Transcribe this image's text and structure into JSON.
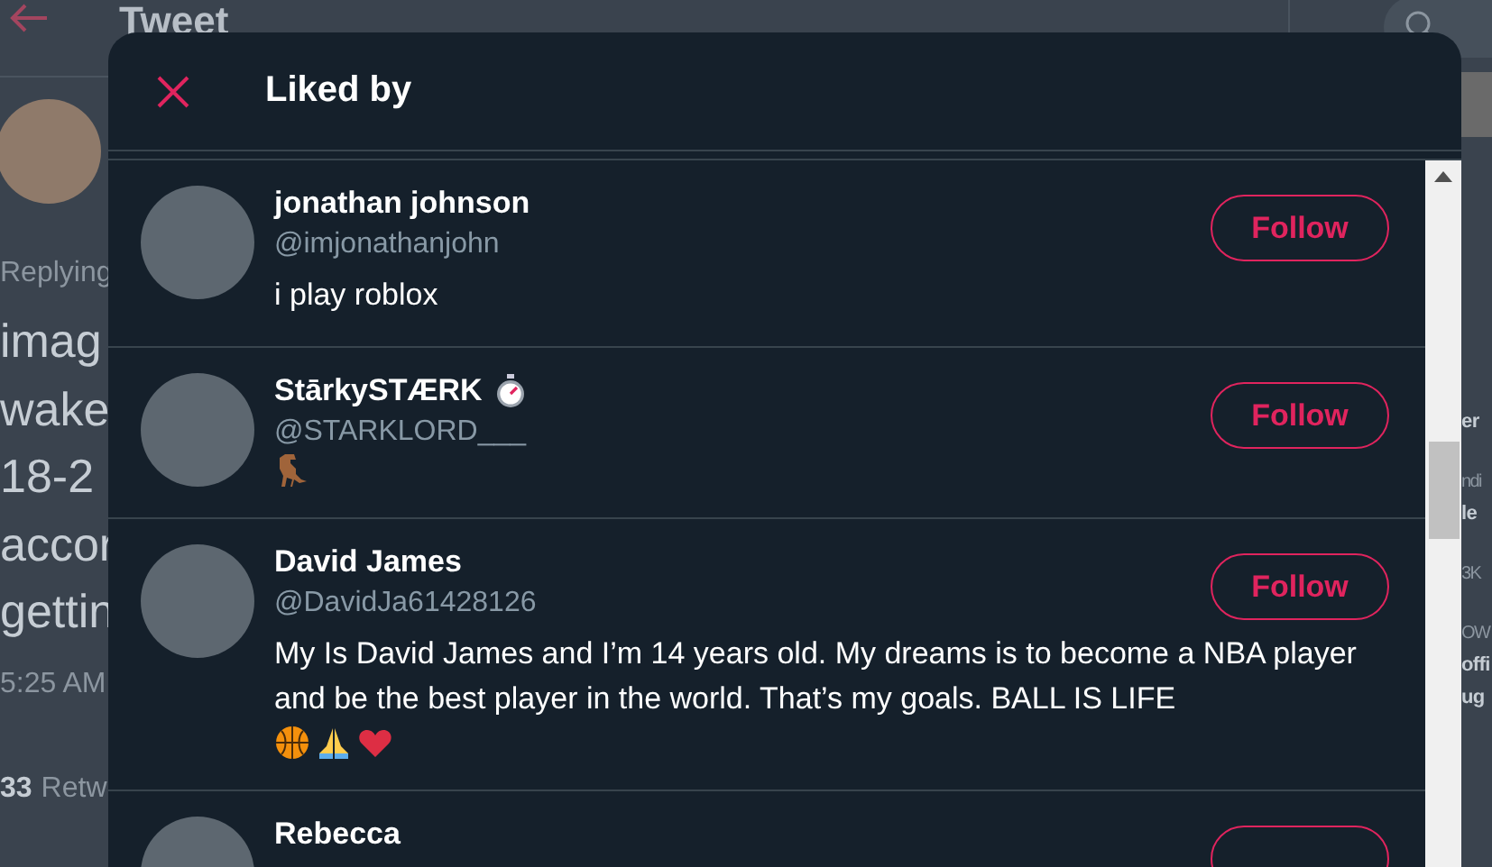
{
  "background_page": {
    "header": {
      "title": "Tweet"
    },
    "tweet": {
      "replying": "Replying",
      "text_lines": [
        "imag",
        "wake",
        "18-2",
        "accor",
        "gettin"
      ],
      "time": "5:25 AM",
      "retweet_count": "33",
      "retweet_label": "Retw"
    },
    "sidebar_fragments": [
      {
        "text": "er",
        "kind": "heading"
      },
      {
        "text": "ndi",
        "kind": "meta"
      },
      {
        "text": "le",
        "kind": "title"
      },
      {
        "text": "3K",
        "kind": "meta"
      },
      {
        "text": "OW",
        "kind": "meta"
      },
      {
        "text": "offi",
        "kind": "title"
      },
      {
        "text": "ug",
        "kind": "title"
      }
    ]
  },
  "modal": {
    "title": "Liked by",
    "users": [
      {
        "name": "jonathan johnson",
        "handle": "@imjonathanjohn",
        "bio": "i play roblox",
        "follow_label": "Follow"
      },
      {
        "name": "StārkySTÆRK",
        "handle": "@STARKLORD___",
        "follow_label": "Follow",
        "name_emojis": [
          {
            "kind": "stopwatch"
          }
        ],
        "bio_emojis": [
          {
            "kind": "dinosaur"
          }
        ]
      },
      {
        "name": "David James",
        "handle": "@DavidJa61428126",
        "bio": "My Is David James and I’m 14 years old. My dreams is to become a NBA player and be the best player in the world. That’s my goals. BALL IS LIFE",
        "follow_label": "Follow",
        "bio_emojis": [
          {
            "kind": "basketball"
          },
          {
            "kind": "praying-hands"
          },
          {
            "kind": "heart"
          }
        ]
      },
      {
        "name": "Rebecca"
      }
    ]
  }
}
